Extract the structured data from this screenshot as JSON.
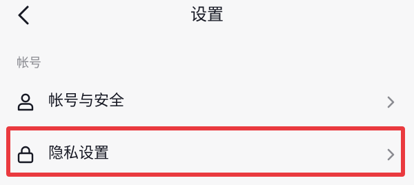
{
  "header": {
    "title": "设置",
    "back_icon": "chevron-left-icon"
  },
  "section": {
    "title": "帐号"
  },
  "items": [
    {
      "label": "帐号与安全",
      "icon": "user-icon"
    },
    {
      "label": "隐私设置",
      "icon": "lock-icon"
    }
  ],
  "colors": {
    "background": "#f7f7f8",
    "text_primary": "#161823",
    "text_secondary": "#8a8b91",
    "highlight": "#ea3a3f",
    "chevron": "#8a8b91"
  }
}
